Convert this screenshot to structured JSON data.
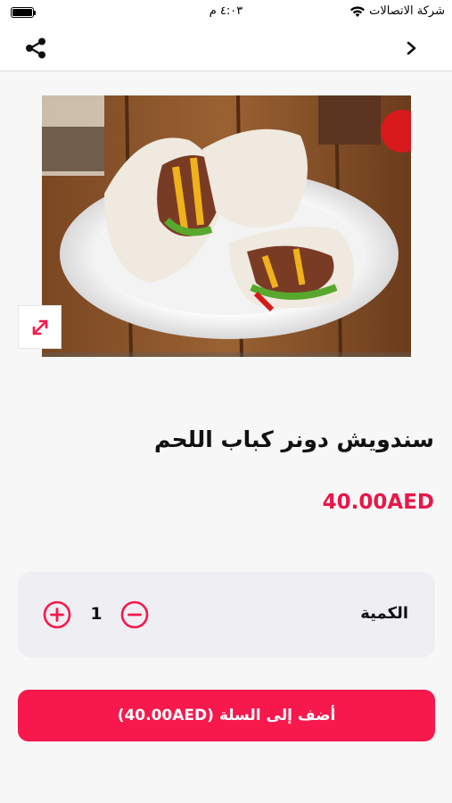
{
  "status_bar": {
    "carrier": "شركة الاتصالات",
    "time": "٤:٠٣ م",
    "icons": [
      "wifi-icon",
      "battery-icon"
    ]
  },
  "nav": {
    "icons": [
      "share-icon",
      "chevron-right-icon"
    ]
  },
  "product": {
    "image_description": "beef doner wrap on plate",
    "title": "سندويش دونر كباب اللحم",
    "price": "40.00AED"
  },
  "quantity": {
    "label": "الكمية",
    "value": "1",
    "icons": [
      "minus-circle-icon",
      "plus-circle-icon"
    ]
  },
  "cart_button": {
    "label": "أضف إلى السلة (40.00AED)"
  },
  "colors": {
    "accent": "#f7184c",
    "price": "#e8174a",
    "card_background": "#efeff3",
    "page_background": "#f7f7f7"
  }
}
